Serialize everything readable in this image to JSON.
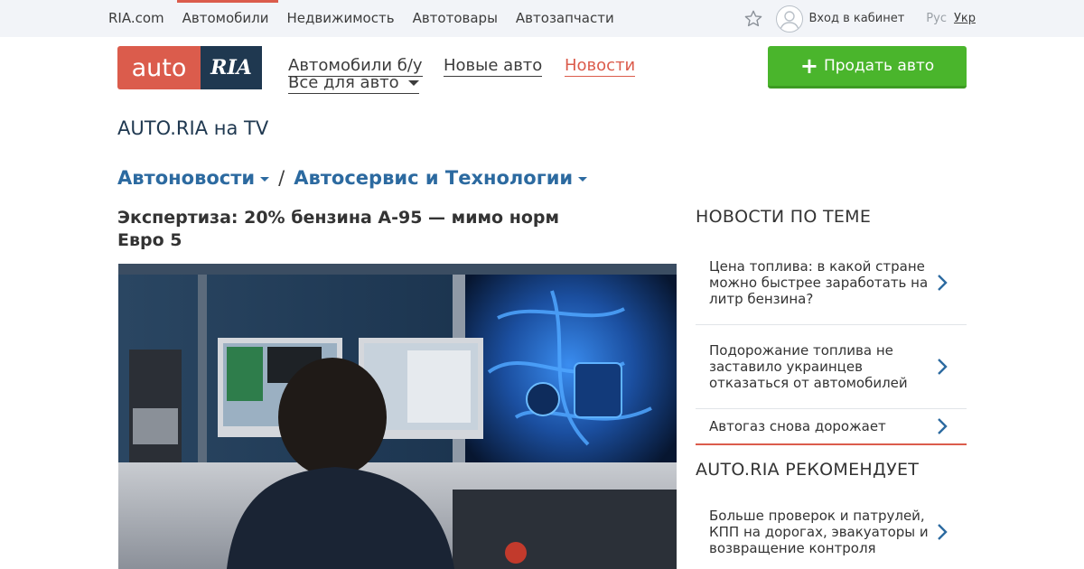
{
  "topbar": {
    "links": [
      "RIA.com",
      "Автомобили",
      "Недвижимость",
      "Автотовары",
      "Автозапчасти"
    ],
    "login": "Вход в кабинет",
    "lang_ru": "Рус",
    "lang_ua": "Укр"
  },
  "logo": {
    "auto": "auto",
    "ria": "RIA"
  },
  "mainnav": {
    "used": "Автомобили б/у",
    "new": "Новые авто",
    "news": "Новости",
    "all": "Все для авто"
  },
  "sell_button": "Продать авто",
  "tv_title": "AUTO.RIA на TV",
  "breadcrumb": {
    "first": "Автоновости",
    "separator": "/",
    "second": "Автосервис и Технологии"
  },
  "headline": "Экспертиза: 20% бензина А-95 — мимо норм Евро 5",
  "sidebar": {
    "related_title": "НОВОСТИ ПО ТЕМЕ",
    "related": [
      "Цена топлива: в какой стране можно быстрее заработать на литр бензина?",
      "Подорожание топлива не заставило украинцев отказаться от автомобилей",
      "Автогаз снова дорожает"
    ],
    "recommends_title": "AUTO.RIA РЕКОМЕНДУЕТ",
    "recommends": [
      "Больше проверок и патрулей, КПП на дорогах, эвакуаторы и возвращение контроля"
    ]
  },
  "colors": {
    "brand_red": "#db5c4c",
    "brand_navy": "#1f3850",
    "sell_green": "#4ab52c",
    "link_blue": "#2c6aa0"
  },
  "icons": [
    "star-icon",
    "user-icon",
    "caret-down-icon",
    "plus-icon",
    "chevron-right-icon"
  ]
}
